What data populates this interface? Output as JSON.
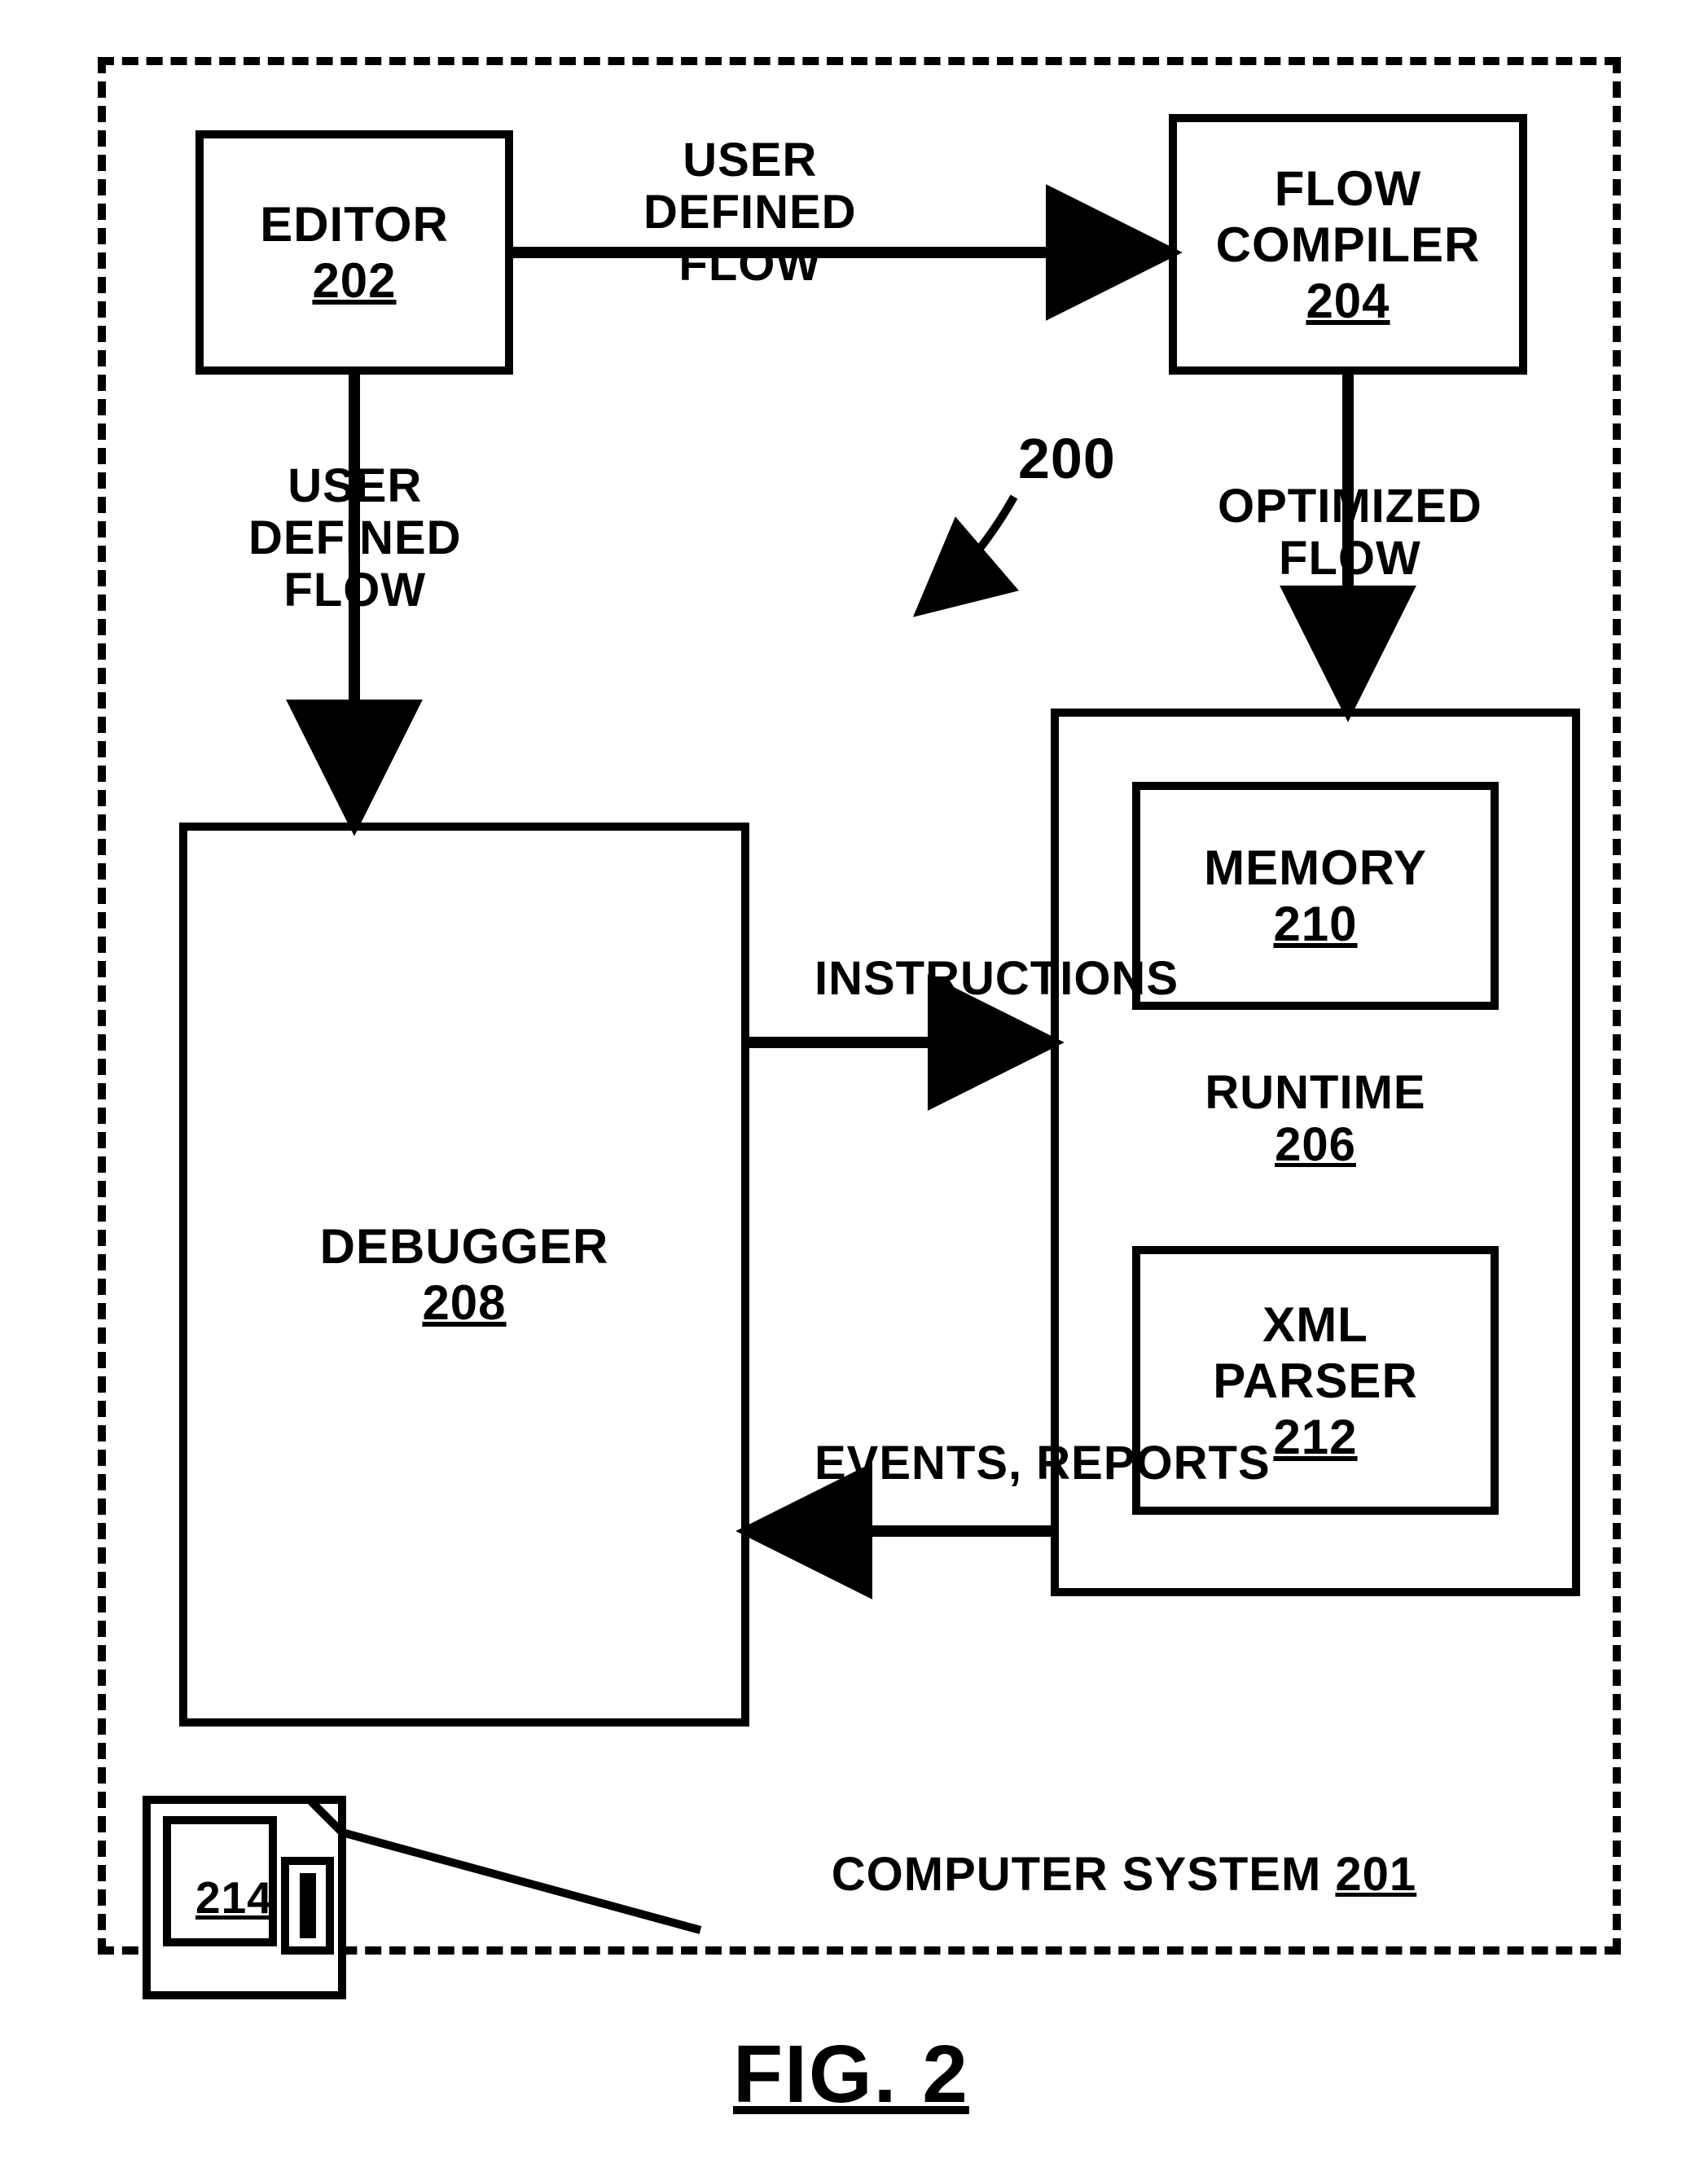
{
  "refNumber": "200",
  "systemLabel": "COMPUTER SYSTEM",
  "systemRef": "201",
  "editor": {
    "title": "EDITOR",
    "ref": "202"
  },
  "compiler": {
    "title1": "FLOW",
    "title2": "COMPILER",
    "ref": "204"
  },
  "runtime": {
    "title": "RUNTIME",
    "ref": "206"
  },
  "memory": {
    "title": "MEMORY",
    "ref": "210"
  },
  "xmlparser": {
    "title1": "XML",
    "title2": "PARSER",
    "ref": "212"
  },
  "debugger": {
    "title": "DEBUGGER",
    "ref": "208"
  },
  "disk": {
    "ref": "214"
  },
  "labels": {
    "userDefinedFlow1": "USER\nDEFINED\nFLOW",
    "userDefinedFlow2": "USER\nDEFINED\nFLOW",
    "optimizedFlow": "OPTIMIZED\nFLOW",
    "instructions": "INSTRUCTIONS",
    "eventsReports": "EVENTS, REPORTS"
  },
  "figure": "FIG. 2"
}
